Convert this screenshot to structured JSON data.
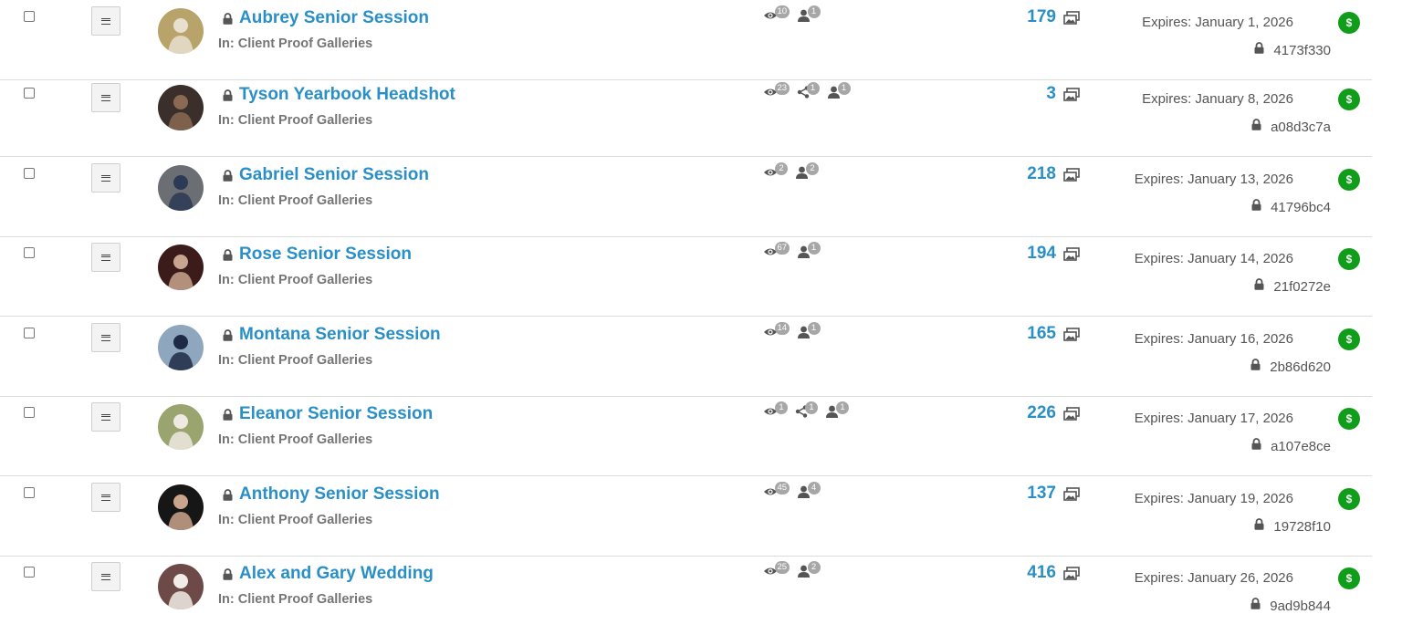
{
  "galleries": [
    {
      "title": "Aubrey Senior Session",
      "folder": "In: Client Proof Galleries",
      "stats": [
        {
          "icon": "eye-icon",
          "value": "10"
        },
        {
          "icon": "person-icon",
          "value": "1"
        }
      ],
      "photos": "179",
      "expires": "Expires: January 1, 2026",
      "code": "4173f330",
      "avatar": {
        "bg": "#b8a46a",
        "fg": "#e8e0cf"
      }
    },
    {
      "title": "Tyson Yearbook Headshot",
      "folder": "In: Client Proof Galleries",
      "stats": [
        {
          "icon": "eye-icon",
          "value": "23"
        },
        {
          "icon": "share-icon",
          "value": "1"
        },
        {
          "icon": "person-icon",
          "value": "1"
        }
      ],
      "photos": "3",
      "expires": "Expires: January 8, 2026",
      "code": "a08d3c7a",
      "avatar": {
        "bg": "#3a2f2a",
        "fg": "#8a6a52"
      }
    },
    {
      "title": "Gabriel Senior Session",
      "folder": "In: Client Proof Galleries",
      "stats": [
        {
          "icon": "eye-icon",
          "value": "2"
        },
        {
          "icon": "person-icon",
          "value": "2"
        }
      ],
      "photos": "218",
      "expires": "Expires: January 13, 2026",
      "code": "41796bc4",
      "avatar": {
        "bg": "#6b6f74",
        "fg": "#2b3a55"
      }
    },
    {
      "title": "Rose Senior Session",
      "folder": "In: Client Proof Galleries",
      "stats": [
        {
          "icon": "eye-icon",
          "value": "67"
        },
        {
          "icon": "person-icon",
          "value": "1"
        }
      ],
      "photos": "194",
      "expires": "Expires: January 14, 2026",
      "code": "21f0272e",
      "avatar": {
        "bg": "#3b1c1a",
        "fg": "#c8a58e"
      }
    },
    {
      "title": "Montana Senior Session",
      "folder": "In: Client Proof Galleries",
      "stats": [
        {
          "icon": "eye-icon",
          "value": "14"
        },
        {
          "icon": "person-icon",
          "value": "1"
        }
      ],
      "photos": "165",
      "expires": "Expires: January 16, 2026",
      "code": "2b86d620",
      "avatar": {
        "bg": "#8fa6bf",
        "fg": "#1f2a44"
      }
    },
    {
      "title": "Eleanor Senior Session",
      "folder": "In: Client Proof Galleries",
      "stats": [
        {
          "icon": "eye-icon",
          "value": "1"
        },
        {
          "icon": "share-icon",
          "value": "1"
        },
        {
          "icon": "person-icon",
          "value": "1"
        }
      ],
      "photos": "226",
      "expires": "Expires: January 17, 2026",
      "code": "a107e8ce",
      "avatar": {
        "bg": "#9aa46e",
        "fg": "#efe9e2"
      }
    },
    {
      "title": "Anthony Senior Session",
      "folder": "In: Client Proof Galleries",
      "stats": [
        {
          "icon": "eye-icon",
          "value": "45"
        },
        {
          "icon": "person-icon",
          "value": "4"
        }
      ],
      "photos": "137",
      "expires": "Expires: January 19, 2026",
      "code": "19728f10",
      "avatar": {
        "bg": "#161616",
        "fg": "#caa58c"
      }
    },
    {
      "title": "Alex and Gary Wedding",
      "folder": "In: Client Proof Galleries",
      "stats": [
        {
          "icon": "eye-icon",
          "value": "25"
        },
        {
          "icon": "person-icon",
          "value": "2"
        }
      ],
      "photos": "416",
      "expires": "Expires: January 26, 2026",
      "code": "9ad9b844",
      "avatar": {
        "bg": "#6d4a48",
        "fg": "#f2ece8"
      }
    }
  ],
  "paid_badge": "$",
  "colors": {
    "link": "#2a8fc7",
    "paid": "#0f9d1a",
    "badge": "#a7a7a7"
  }
}
